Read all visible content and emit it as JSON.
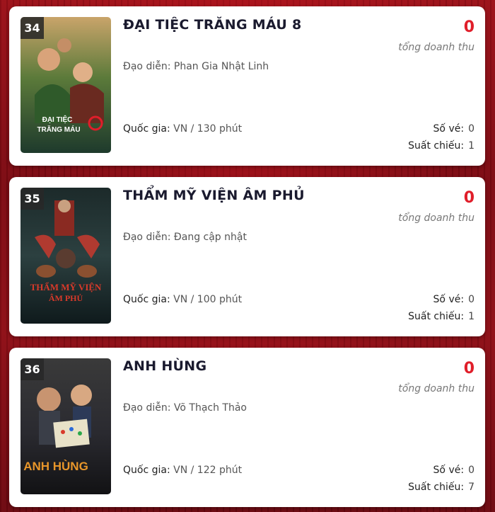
{
  "labels": {
    "director": "Đạo diễn:",
    "country": "Quốc gia:",
    "revenue_caption": "tổng doanh thu",
    "tickets": "Số vé:",
    "showings": "Suất chiếu:"
  },
  "movies": [
    {
      "rank": "34",
      "title": "ĐẠI TIỆC TRĂNG MÁU 8",
      "director": "Phan Gia Nhật Linh",
      "country_duration": "VN / 130 phút",
      "revenue": "0",
      "tickets": "0",
      "showings": "1",
      "poster_text": "ĐẠI TIỆC TRĂNG MÁU 8"
    },
    {
      "rank": "35",
      "title": "THẨM MỸ VIỆN ÂM PHỦ",
      "director": "Đang cập nhật",
      "country_duration": "VN / 100 phút",
      "revenue": "0",
      "tickets": "0",
      "showings": "1",
      "poster_text": "THẨM MỸ VIỆN ÂM PHỦ"
    },
    {
      "rank": "36",
      "title": "ANH HÙNG",
      "director": "Võ Thạch Thảo",
      "country_duration": "VN / 122 phút",
      "revenue": "0",
      "tickets": "0",
      "showings": "7",
      "poster_text": "ANH HÙNG"
    }
  ],
  "colors": {
    "accent_red": "#e01e2a",
    "background_red": "#8f0e16",
    "title_dark": "#1a1a2e"
  }
}
